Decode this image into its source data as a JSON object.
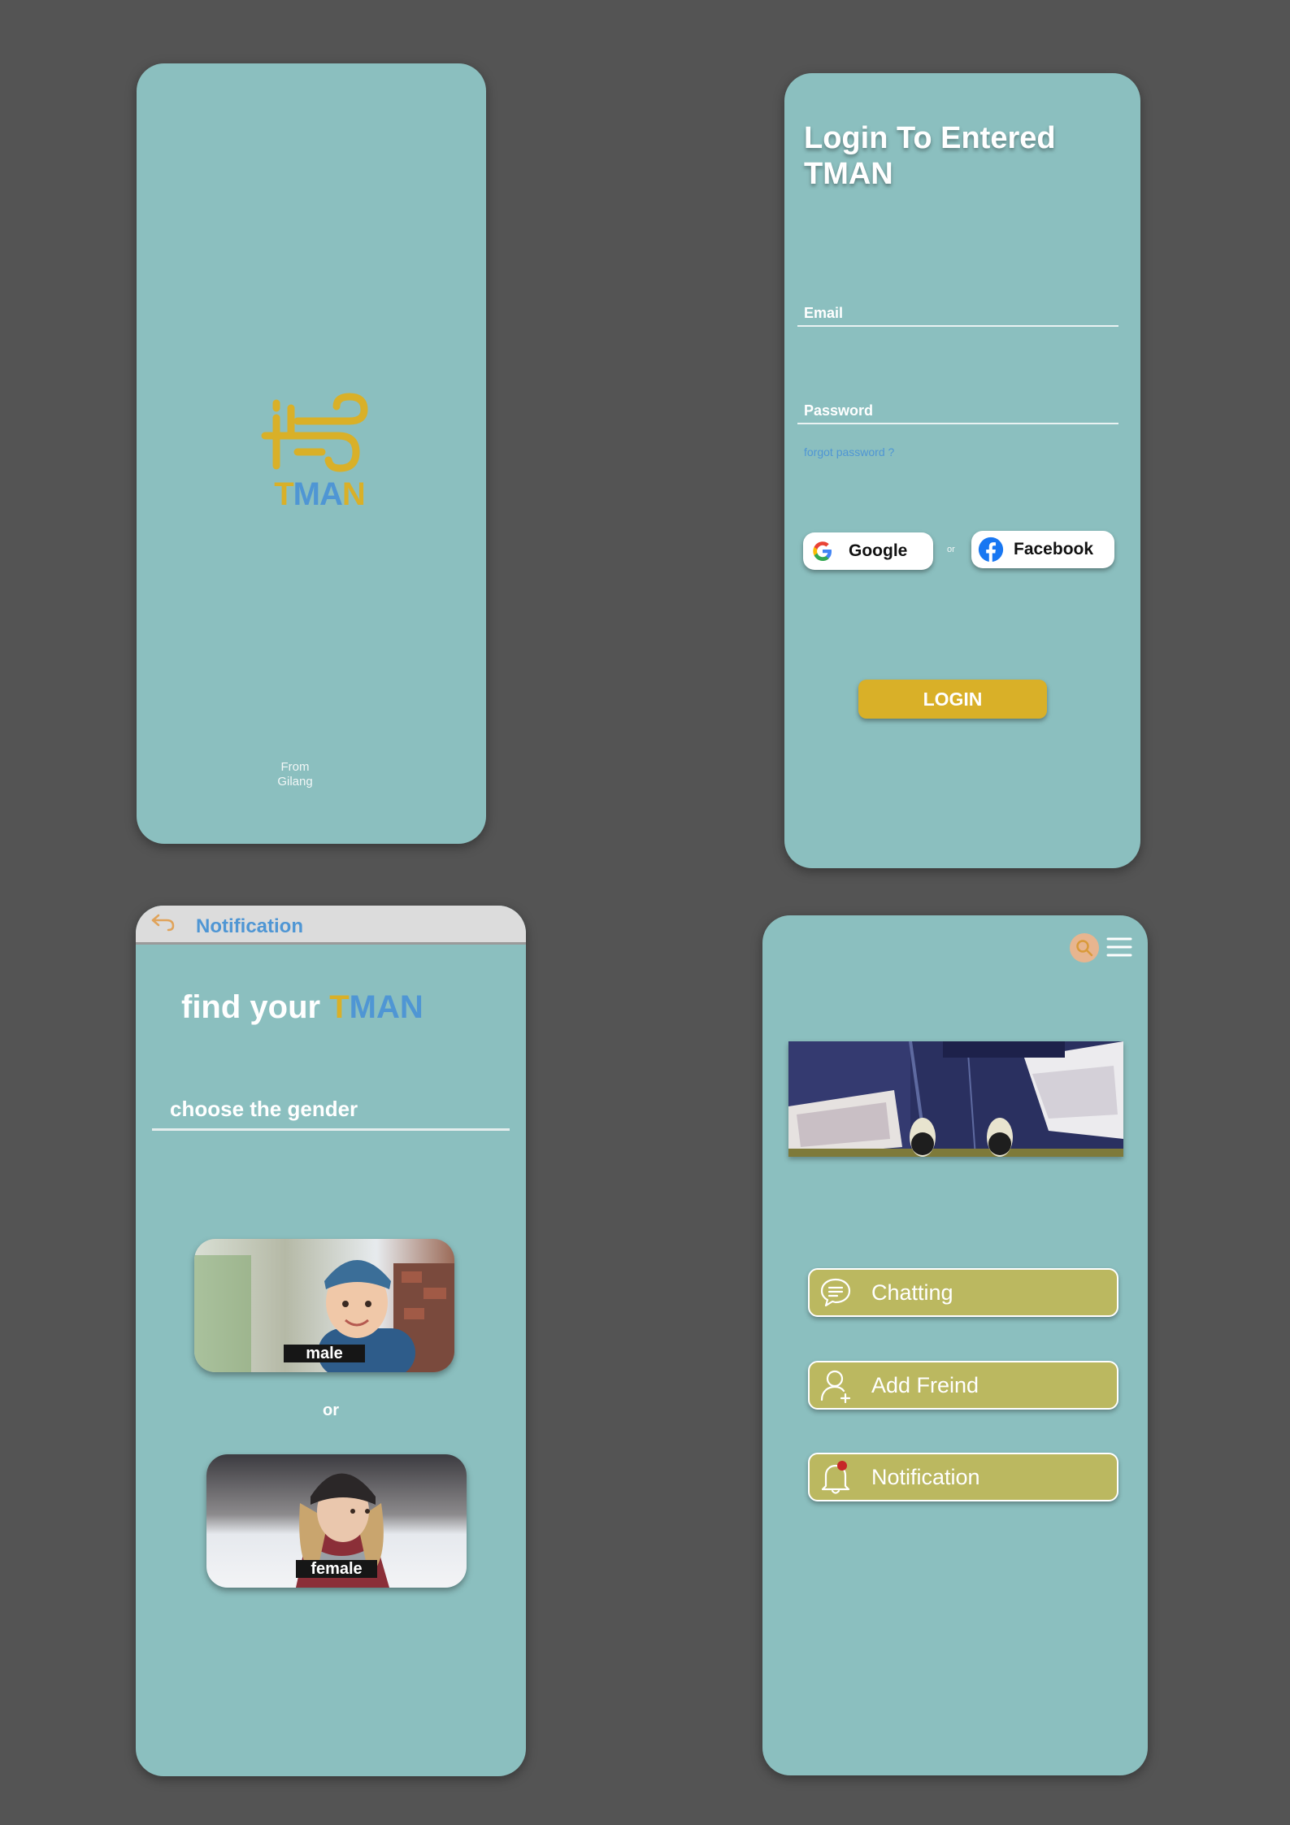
{
  "splash": {
    "logo_text": {
      "t": "T",
      "m": "M",
      "a": "A",
      "n": "N"
    },
    "from_line1": "From",
    "from_line2": "Gilang"
  },
  "login": {
    "title": "Login To Entered TMAN",
    "email_placeholder": "Email",
    "password_placeholder": "Password",
    "forgot_password": "forgot password ?",
    "google_label": "Google",
    "or_label": "or",
    "facebook_label": "Facebook",
    "login_button": "LOGIN"
  },
  "gender": {
    "header_title": "Notification",
    "find_prefix": "find your",
    "find_t": "T",
    "find_man": "MAN",
    "choose_label": "choose the gender",
    "male_label": "male",
    "or_label": "or",
    "female_label": "female"
  },
  "home": {
    "items": [
      {
        "label": "Chatting",
        "icon": "chat-bubble-icon"
      },
      {
        "label": "Add Freind",
        "icon": "add-friend-icon"
      },
      {
        "label": "Notification",
        "icon": "bell-icon"
      }
    ]
  },
  "colors": {
    "background": "#545454",
    "phone": "#8bbfbf",
    "gold": "#d9b028",
    "blue": "#4f96d4",
    "olive_button": "#bbb860"
  }
}
